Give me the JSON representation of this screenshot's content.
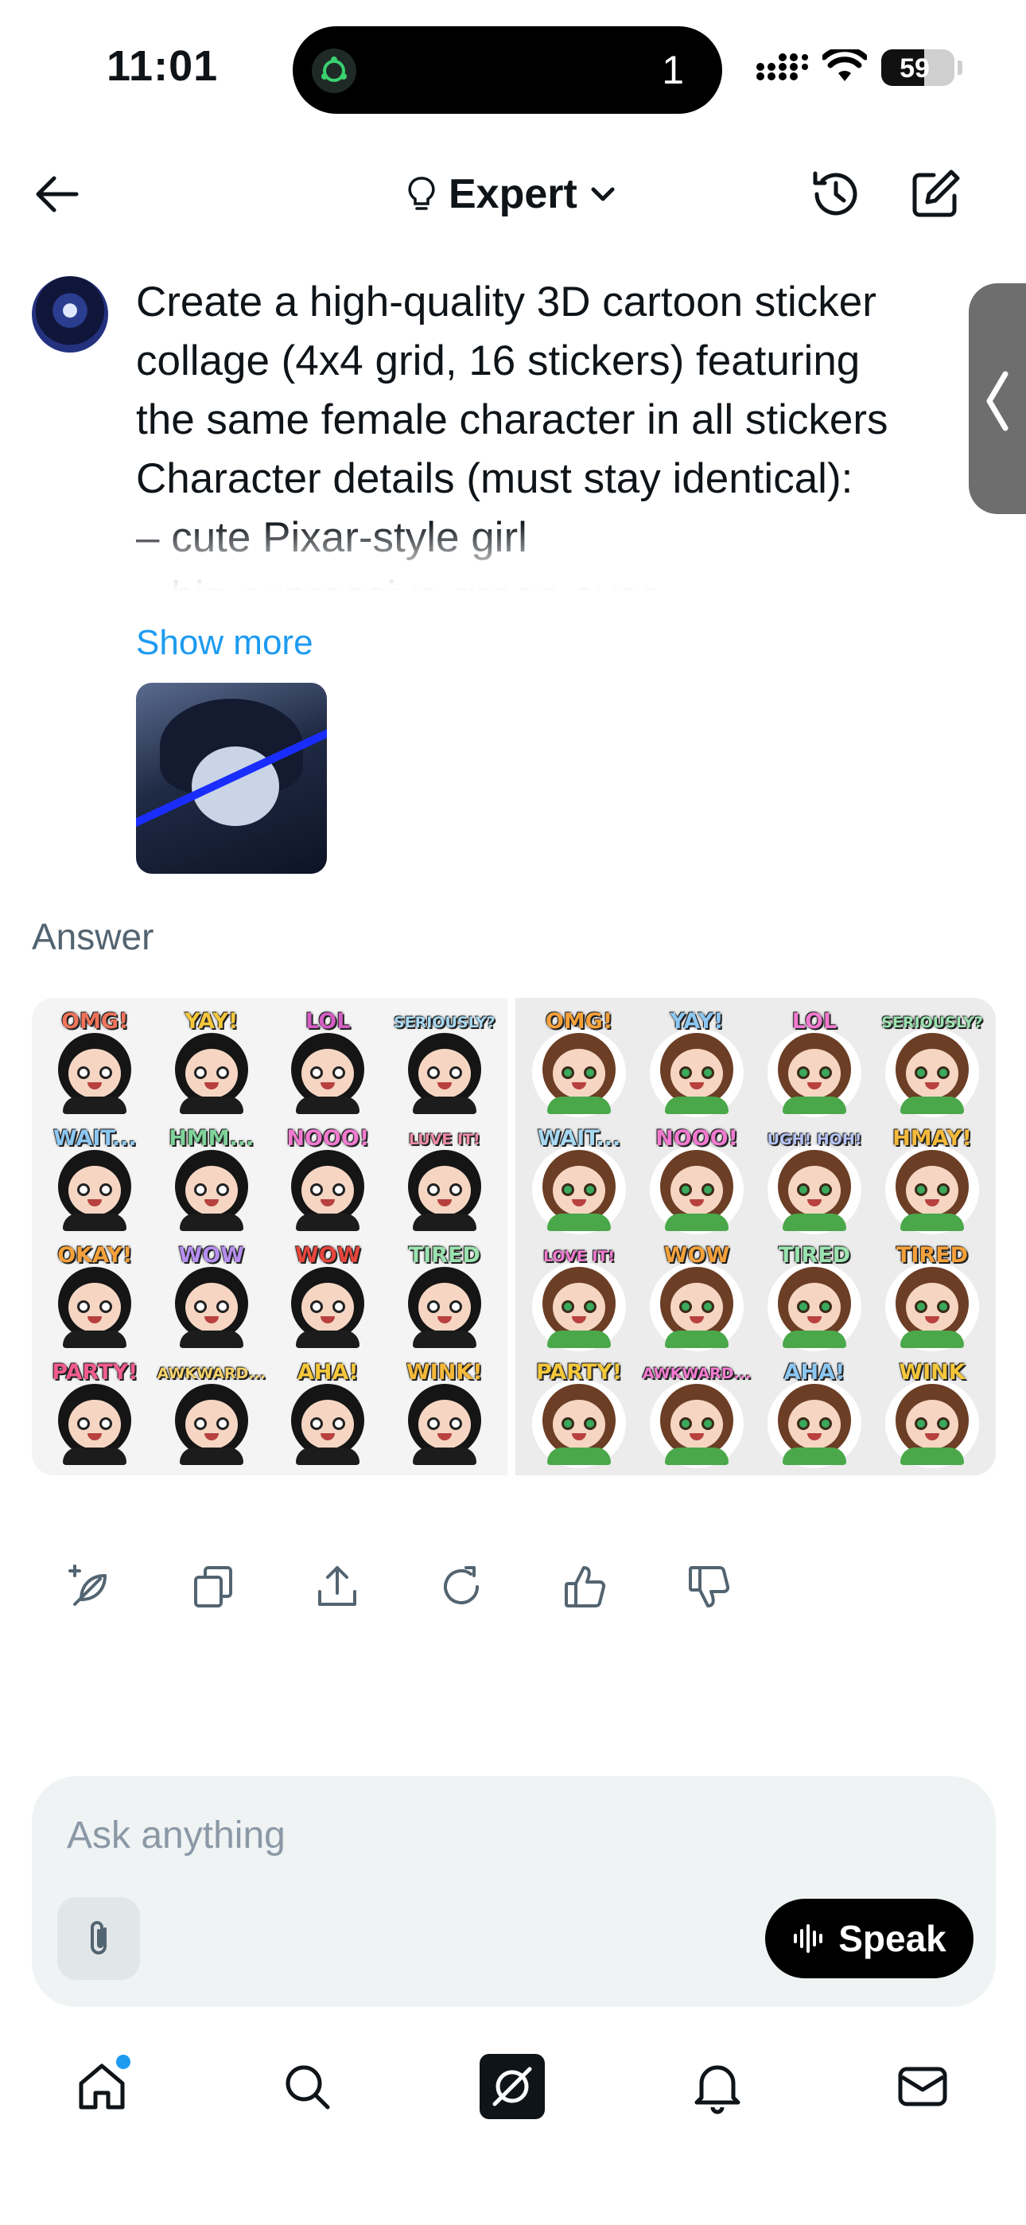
{
  "status_bar": {
    "time": "11:01",
    "island_count": "1",
    "battery_level": "59",
    "battery_percent": 59
  },
  "header": {
    "mode_label": "Expert",
    "icons": [
      "back-arrow-icon",
      "lightbulb-icon",
      "chevron-down-icon",
      "history-icon",
      "compose-icon"
    ]
  },
  "prompt": {
    "lines": [
      "Create a high-quality 3D cartoon sticker",
      "collage (4x4 grid, 16 stickers) featuring",
      "the same female character in all stickers",
      "Character details (must stay identical):",
      "– cute Pixar-style girl",
      "– big expressive green eyes"
    ],
    "show_more_label": "Show more"
  },
  "answer": {
    "label": "Answer",
    "sticker_sets": [
      {
        "stickers": [
          "OMG!",
          "YAY!",
          "LOL",
          "SERIOUSLY?",
          "WAIT...",
          "HMM...",
          "NOOO!",
          "LUVE IT!",
          "OKAY!",
          "WOW",
          "WOW",
          "TIRED",
          "PARTY!",
          "AWKWARD...",
          "AHA!",
          "WINK!"
        ]
      },
      {
        "stickers": [
          "OMG!",
          "YAY!",
          "LOL",
          "SERIOUSLY?",
          "WAIT...",
          "NOOO!",
          "UGH! HOH!",
          "HMAY!",
          "LOVE IT!",
          "WOW",
          "TIRED",
          "TIRED",
          "PARTY!",
          "AWKWARD...",
          "AHA!",
          "WINK"
        ]
      }
    ]
  },
  "action_icons": [
    "grok-sparkle-icon",
    "copy-icon",
    "share-icon",
    "regenerate-icon",
    "thumbs-up-icon",
    "thumbs-down-icon"
  ],
  "composer": {
    "placeholder": "Ask anything",
    "speak_label": "Speak"
  },
  "tabbar": {
    "items": [
      "home-icon",
      "search-icon",
      "grok-icon",
      "notifications-icon",
      "messages-icon"
    ],
    "home_has_badge": true
  },
  "colors": {
    "accent": "#1d9bf0",
    "text": "#0f1419",
    "muted": "#536471",
    "composer_bg": "#eff3f4"
  }
}
